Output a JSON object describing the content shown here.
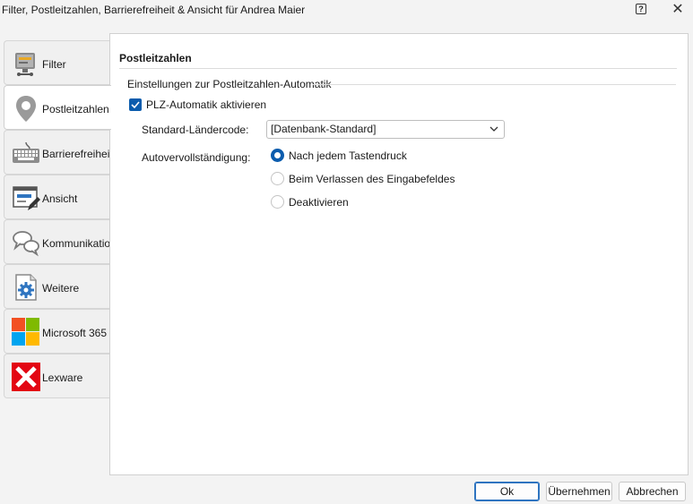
{
  "window": {
    "title": "Filter, Postleitzahlen, Barrierefreiheit & Ansicht für Andrea Maier",
    "help_label": "?",
    "close_label": "✕"
  },
  "tabs": [
    {
      "label": "Filter",
      "icon": "filter-icon"
    },
    {
      "label": "Postleitzahlen",
      "icon": "map-pin-icon",
      "active": true
    },
    {
      "label": "Barrierefreiheit",
      "icon": "keyboard-icon"
    },
    {
      "label": "Ansicht",
      "icon": "view-edit-icon"
    },
    {
      "label": "Kommunikation",
      "icon": "chat-bubbles-icon"
    },
    {
      "label": "Weitere",
      "icon": "gear-document-icon"
    },
    {
      "label": "Microsoft 365",
      "icon": "microsoft-logo-icon"
    },
    {
      "label": "Lexware",
      "icon": "lexware-logo-icon"
    }
  ],
  "content": {
    "section_title": "Postleitzahlen",
    "group_title": "Einstellungen zur Postleitzahlen-Automatik",
    "plz_checkbox": {
      "label": "PLZ-Automatik aktivieren",
      "checked": true
    },
    "country_code": {
      "label": "Standard-Ländercode:",
      "value": "[Datenbank-Standard]"
    },
    "autocomplete": {
      "label": "Autovervollständigung:",
      "options": [
        {
          "label": "Nach jedem Tastendruck",
          "selected": true
        },
        {
          "label": "Beim Verlassen des Eingabefeldes",
          "selected": false
        },
        {
          "label": "Deaktivieren",
          "selected": false
        }
      ]
    }
  },
  "buttons": {
    "ok": "Ok",
    "apply": "Übernehmen",
    "cancel": "Abbrechen"
  },
  "colors": {
    "accent": "#0b5cad",
    "ms_red": "#f25022",
    "ms_green": "#7fba00",
    "ms_blue": "#00a4ef",
    "ms_yellow": "#ffb900",
    "lexware_red": "#e30613"
  }
}
